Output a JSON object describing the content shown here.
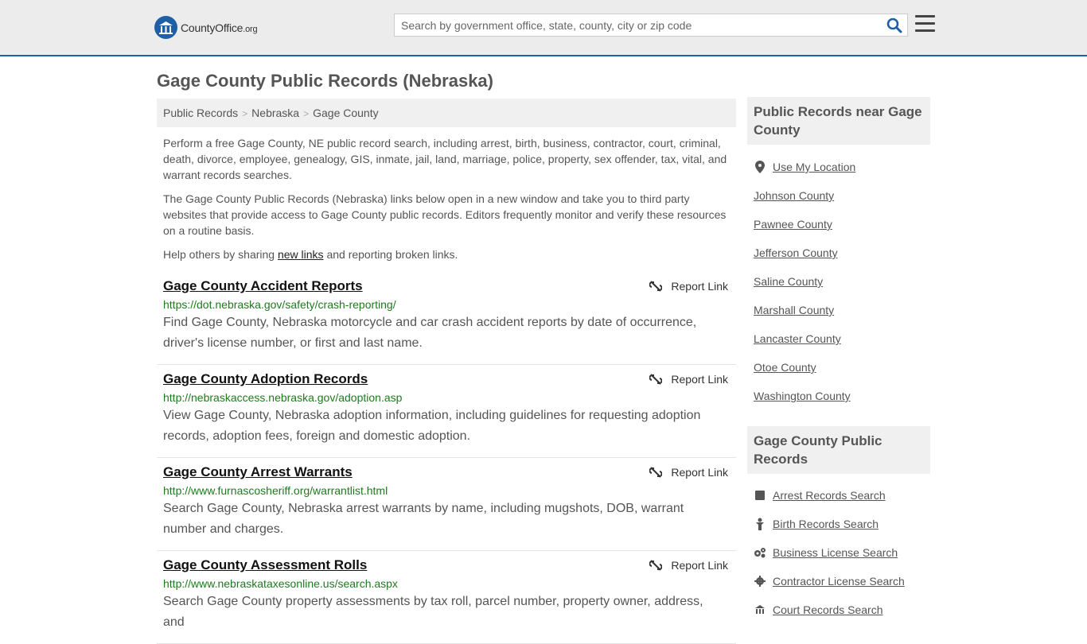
{
  "header": {
    "logo_main": "CountyOffice",
    "logo_suffix": ".org",
    "search_placeholder": "Search by government office, state, county, city or zip code"
  },
  "page_title": "Gage County Public Records (Nebraska)",
  "breadcrumb": [
    "Public Records",
    "Nebraska",
    "Gage County"
  ],
  "intro": {
    "p1": "Perform a free Gage County, NE public record search, including arrest, birth, business, contractor, court, criminal, death, divorce, employee, genealogy, GIS, inmate, jail, land, marriage, police, property, sex offender, tax, vital, and warrant records searches.",
    "p2": "The Gage County Public Records (Nebraska) links below open in a new window and take you to third party websites that provide access to Gage County public records. Editors frequently monitor and verify these resources on a routine basis.",
    "p3_before": "Help others by sharing ",
    "p3_link": "new links",
    "p3_after": " and reporting broken links."
  },
  "report_label": "Report Link",
  "records": [
    {
      "title": "Gage County Accident Reports",
      "url": "https://dot.nebraska.gov/safety/crash-reporting/",
      "desc": "Find Gage County, Nebraska motorcycle and car crash accident reports by date of occurrence, driver's license number, or first and last name."
    },
    {
      "title": "Gage County Adoption Records",
      "url": "http://nebraskaccess.nebraska.gov/adoption.asp",
      "desc": "View Gage County, Nebraska adoption information, including guidelines for requesting adoption records, adoption fees, foreign and domestic adoption."
    },
    {
      "title": "Gage County Arrest Warrants",
      "url": "http://www.furnascosheriff.org/warrantlist.html",
      "desc": "Search Gage County, Nebraska arrest warrants by name, including mugshots, DOB, warrant number and charges."
    },
    {
      "title": "Gage County Assessment Rolls",
      "url": "http://www.nebraskataxesonline.us/search.aspx",
      "desc": "Search Gage County property assessments by tax roll, parcel number, property owner, address, and"
    }
  ],
  "sidebar": {
    "near_title": "Public Records near Gage County",
    "use_location": "Use My Location",
    "near_counties": [
      "Johnson County",
      "Pawnee County",
      "Jefferson County",
      "Saline County",
      "Marshall County",
      "Lancaster County",
      "Otoe County",
      "Washington County"
    ],
    "records_title": "Gage County Public Records",
    "record_links": [
      {
        "label": "Arrest Records Search",
        "icon": "arrest-icon"
      },
      {
        "label": "Birth Records Search",
        "icon": "birth-icon"
      },
      {
        "label": "Business License Search",
        "icon": "business-icon"
      },
      {
        "label": "Contractor License Search",
        "icon": "contractor-icon"
      },
      {
        "label": "Court Records Search",
        "icon": "court-icon"
      }
    ]
  },
  "colors": {
    "brand_blue": "#1f5fa6",
    "url_green": "#1f7a1f"
  }
}
